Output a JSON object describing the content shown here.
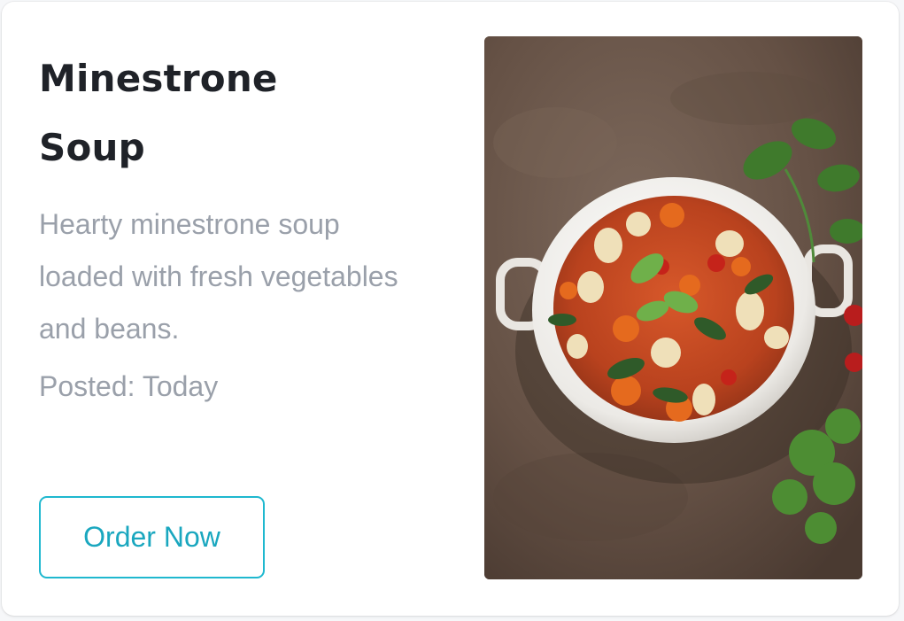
{
  "card": {
    "title": "Minestrone Soup",
    "description": "Hearty minestrone soup loaded with fresh vegetables and beans.",
    "posted": "Posted: Today",
    "order_button_label": "Order Now",
    "accent_color": "#1fb8cf"
  },
  "image": {
    "subject": "minestrone-soup-photo"
  }
}
